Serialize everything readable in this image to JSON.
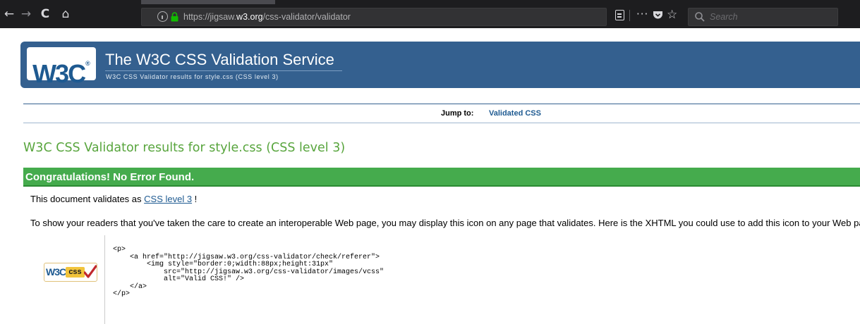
{
  "browser": {
    "url_prefix": "https://jigsaw.",
    "url_domain": "w3.org",
    "url_path": "/css-validator/validator",
    "search_placeholder": "Search",
    "back_glyph": "←",
    "forward_glyph": "→",
    "reload_glyph": "C",
    "home_glyph": "⌂",
    "menu_glyph": "···",
    "bookmark_glyph": "☆"
  },
  "header": {
    "logo_text": "W3C",
    "logo_mark": "®",
    "title": "The W3C CSS Validation Service",
    "subtitle": "W3C CSS Validator results for style.css (CSS level 3)"
  },
  "jump": {
    "label": "Jump to:",
    "link": "Validated CSS"
  },
  "results": {
    "title": "W3C CSS Validator results for style.css (CSS level 3)",
    "congrats": "Congratulations! No Error Found.",
    "validates_prefix": "This document validates as ",
    "validates_link": "CSS level 3",
    "validates_suffix": " !",
    "show_text": "To show your readers that you've taken the care to create an interoperable Web page, you may display this icon on any page that validates. Here is the XHTML you could use to add this icon to your Web page:"
  },
  "badge": {
    "w3c": "W3C",
    "css": "css"
  },
  "code": {
    "snippet": "<p>\n    <a href=\"http://jigsaw.w3.org/css-validator/check/referer\">\n        <img style=\"border:0;width:88px;height:31px\"\n            src=\"http://jigsaw.w3.org/css-validator/images/vcss\"\n            alt=\"Valid CSS!\" />\n    </a>\n</p>"
  },
  "colors": {
    "banner": "#34608f",
    "results_title": "#58a53d",
    "congrats_bar": "#45ab4d",
    "link": "#1e5a91"
  }
}
